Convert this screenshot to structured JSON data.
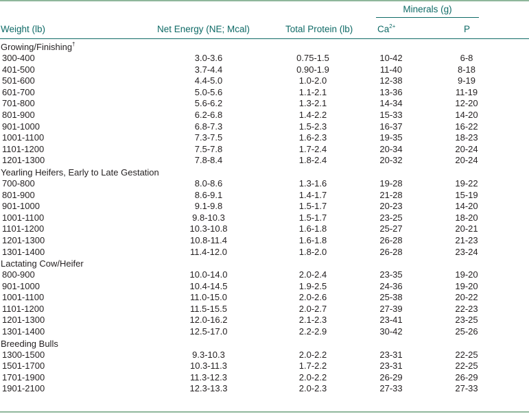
{
  "headers": {
    "weight": "Weight (lb)",
    "net_energy": "Net Energy (NE; Mcal)",
    "total_protein": "Total Protein (lb)",
    "minerals": "Minerals (g)",
    "ca": "Ca2+",
    "p": "P"
  },
  "sections": [
    {
      "title": "Growing/Finishing",
      "marker": "†",
      "rows": [
        [
          "300-400",
          "3.0-3.6",
          "0.75-1.5",
          "10-42",
          "6-8"
        ],
        [
          "401-500",
          "3.7-4.4",
          "0.90-1.9",
          "11-40",
          "8-18"
        ],
        [
          "501-600",
          "4.4-5.0",
          "1.0-2.0",
          "12-38",
          "9-19"
        ],
        [
          "601-700",
          "5.0-5.6",
          "1.1-2.1",
          "13-36",
          "11-19"
        ],
        [
          "701-800",
          "5.6-6.2",
          "1.3-2.1",
          "14-34",
          "12-20"
        ],
        [
          "801-900",
          "6.2-6.8",
          "1.4-2.2",
          "15-33",
          "14-20"
        ],
        [
          "901-1000",
          "6.8-7.3",
          "1.5-2.3",
          "16-37",
          "16-22"
        ],
        [
          "1001-1100",
          "7.3-7.5",
          "1.6-2.3",
          "19-35",
          "18-23"
        ],
        [
          "1101-1200",
          "7.5-7.8",
          "1.7-2.4",
          "20-34",
          "20-24"
        ],
        [
          "1201-1300",
          "7.8-8.4",
          "1.8-2.4",
          "20-32",
          "20-24"
        ]
      ]
    },
    {
      "title": "Yearling Heifers, Early to Late Gestation",
      "marker": "",
      "rows": [
        [
          "700-800",
          "8.0-8.6",
          "1.3-1.6",
          "19-28",
          "19-22"
        ],
        [
          "801-900",
          "8.6-9.1",
          "1.4-1.7",
          "21-28",
          "15-19"
        ],
        [
          "901-1000",
          "9.1-9.8",
          "1.5-1.7",
          "20-23",
          "14-20"
        ],
        [
          "1001-1100",
          "9.8-10.3",
          "1.5-1.7",
          "23-25",
          "18-20"
        ],
        [
          "1101-1200",
          "10.3-10.8",
          "1.6-1.8",
          "25-27",
          "20-21"
        ],
        [
          "1201-1300",
          "10.8-11.4",
          "1.6-1.8",
          "26-28",
          "21-23"
        ],
        [
          "1301-1400",
          "11.4-12.0",
          "1.8-2.0",
          "26-28",
          "23-24"
        ]
      ]
    },
    {
      "title": "Lactating Cow/Heifer",
      "marker": "",
      "rows": [
        [
          "800-900",
          "10.0-14.0",
          "2.0-2.4",
          "23-35",
          "19-20"
        ],
        [
          "901-1000",
          "10.4-14.5",
          "1.9-2.5",
          "24-36",
          "19-20"
        ],
        [
          "1001-1100",
          "11.0-15.0",
          "2.0-2.6",
          "25-38",
          "20-22"
        ],
        [
          "1101-1200",
          "11.5-15.5",
          "2.0-2.7",
          "27-39",
          "22-23"
        ],
        [
          "1201-1300",
          "12.0-16.2",
          "2.1-2.3",
          "23-41",
          "23-25"
        ],
        [
          "1301-1400",
          "12.5-17.0",
          "2.2-2.9",
          "30-42",
          "25-26"
        ]
      ]
    },
    {
      "title": "Breeding Bulls",
      "marker": "",
      "rows": [
        [
          "1300-1500",
          "9.3-10.3",
          "2.0-2.2",
          "23-31",
          "22-25"
        ],
        [
          "1501-1700",
          "10.3-11.3",
          "1.7-2.2",
          "23-31",
          "22-25"
        ],
        [
          "1701-1900",
          "11.3-12.3",
          "2.0-2.2",
          "26-29",
          "26-29"
        ],
        [
          "1901-2100",
          "12.3-13.3",
          "2.0-2.3",
          "27-33",
          "27-33"
        ]
      ]
    }
  ]
}
